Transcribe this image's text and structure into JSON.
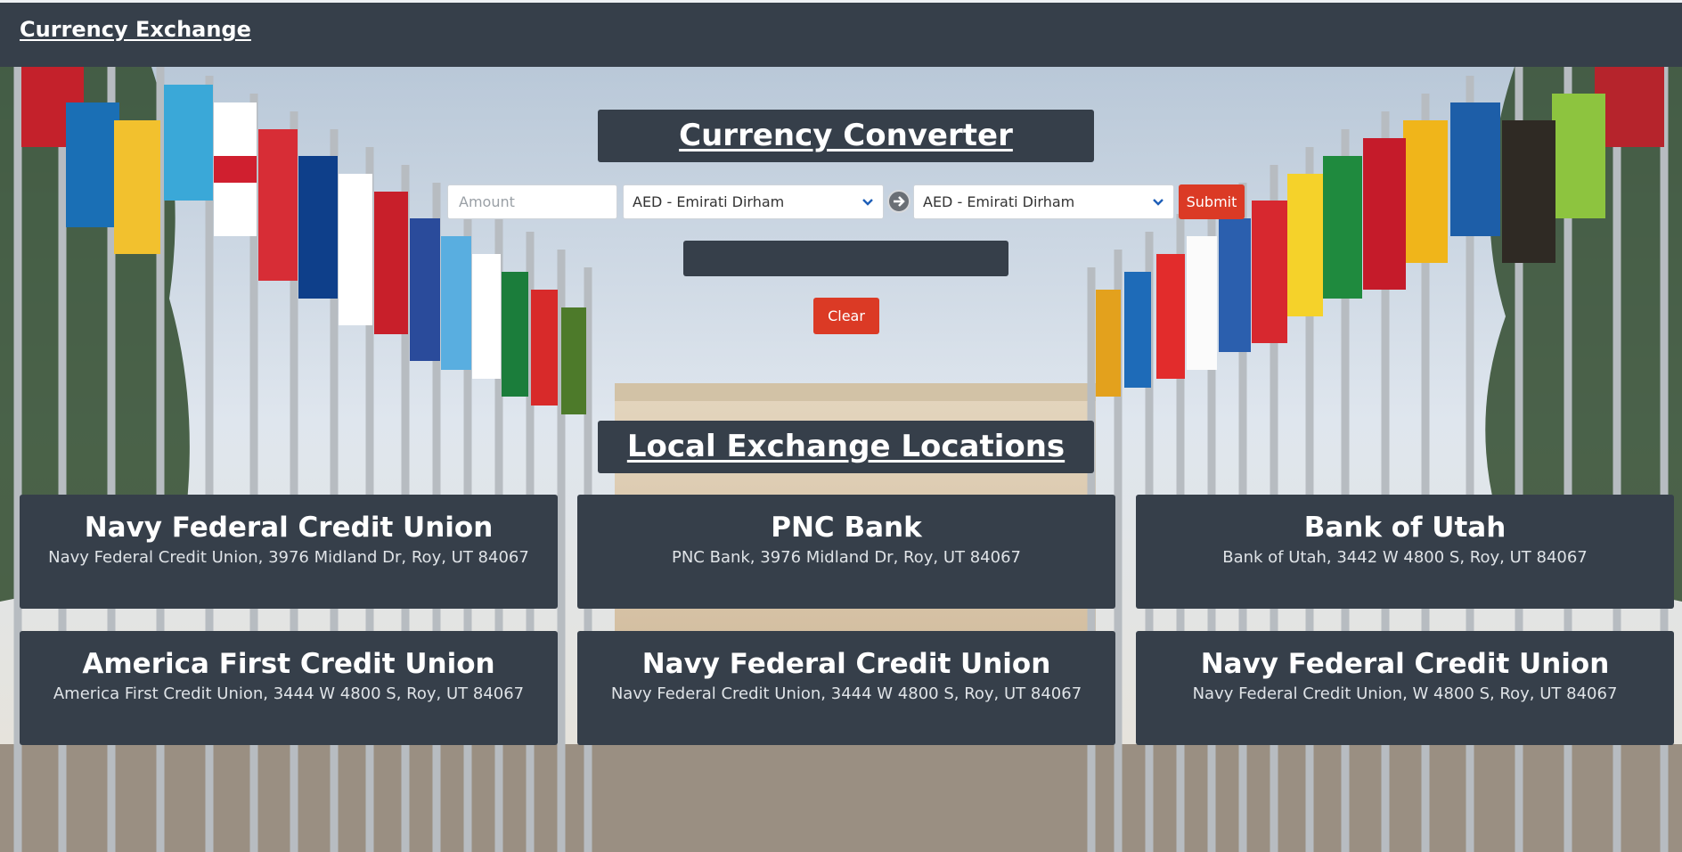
{
  "navbar": {
    "brand": "Currency Exchange"
  },
  "converter": {
    "title": "Currency Converter",
    "amount_placeholder": "Amount",
    "from_currency": "AED - Emirati Dirham",
    "to_currency": "AED - Emirati Dirham",
    "submit_label": "Submit",
    "result_text": "",
    "clear_label": "Clear"
  },
  "locations": {
    "title": "Local Exchange Locations",
    "items": [
      {
        "name": "Navy Federal Credit Union",
        "address": "Navy Federal Credit Union, 3976 Midland Dr, Roy, UT 84067"
      },
      {
        "name": "PNC Bank",
        "address": "PNC Bank, 3976 Midland Dr, Roy, UT 84067"
      },
      {
        "name": "Bank of Utah",
        "address": "Bank of Utah, 3442 W 4800 S, Roy, UT 84067"
      },
      {
        "name": "America First Credit Union",
        "address": "America First Credit Union, 3444 W 4800 S, Roy, UT 84067"
      },
      {
        "name": "Navy Federal Credit Union",
        "address": "Navy Federal Credit Union, 3444 W 4800 S, Roy, UT 84067"
      },
      {
        "name": "Navy Federal Credit Union",
        "address": "Navy Federal Credit Union, W 4800 S, Roy, UT 84067"
      }
    ]
  },
  "colors": {
    "navbar": "#363f4a",
    "panel": "#363f4a",
    "accent_red": "#db3a25"
  },
  "icons": {
    "arrow": "arrow-right-circle-icon",
    "select": "chevron-down-icon"
  }
}
